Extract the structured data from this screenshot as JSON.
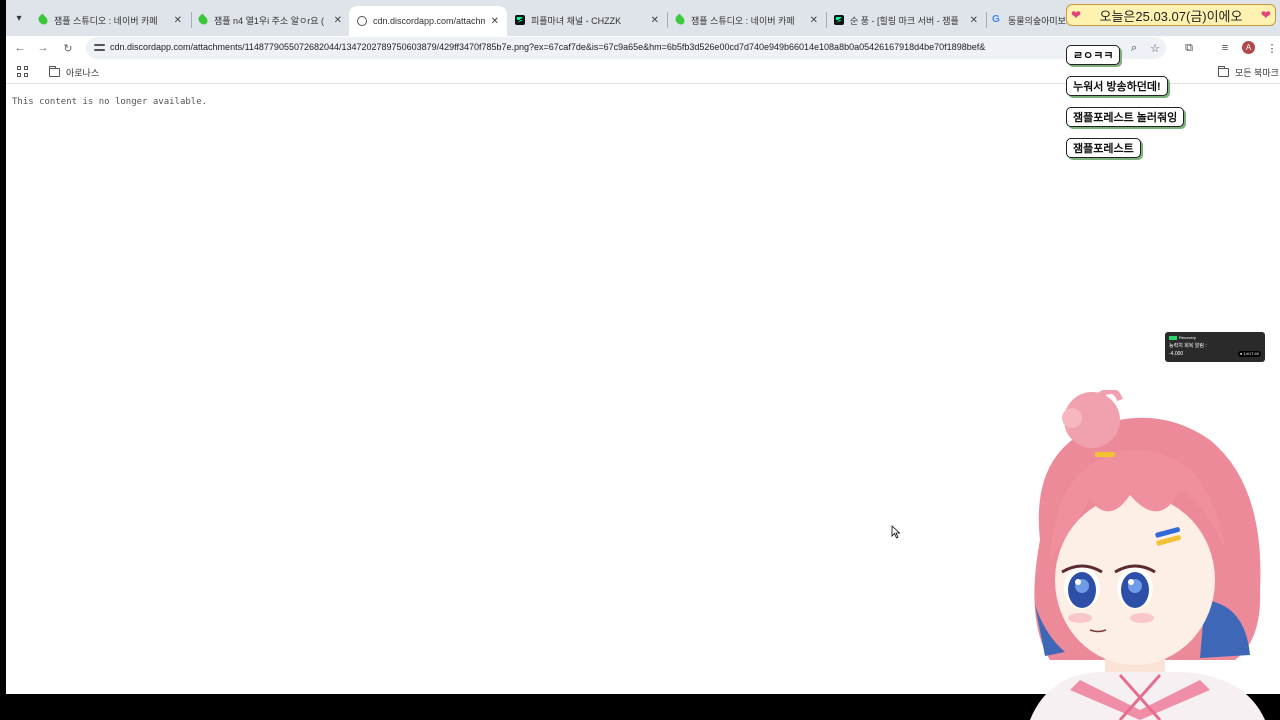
{
  "tabs": [
    {
      "title": "잼플 스튜디오 : 네이버 카페",
      "favicon": "leaf-icon",
      "active": false
    },
    {
      "title": "잼플 n4 열1우i 주소 알ㅇr요 (",
      "favicon": "leaf-icon",
      "active": false
    },
    {
      "title": "cdn.discordapp.com/attachme",
      "favicon": "globe-icon",
      "active": true
    },
    {
      "title": "피플마녀 채널 - CHZZK",
      "favicon": "chzzk-icon",
      "active": false
    },
    {
      "title": "잼플 스튜디오 : 네이버 카페",
      "favicon": "leaf-icon",
      "active": false
    },
    {
      "title": "순 풍 - [힐링 마크 서버 - 잼플",
      "favicon": "chzzk-icon",
      "active": false
    },
    {
      "title": "동물의숲아미보카",
      "favicon": "google-icon",
      "active": false
    }
  ],
  "tab_close_glyph": "✕",
  "google_glyph": "G",
  "url": "cdn.discordapp.com/attachments/1148779055072682044/1347202789750603879/429ff3470f785b7e.png?ex=67caf7de&is=67c9a65e&hm=6b5fb3d526e00cd7d740e949b66014e108a8b0a05426167918d4be70f1898bef&",
  "avatar_letter": "A",
  "bookmarks": {
    "folder": "아로나스",
    "all_bookmarks": "모든 북마크"
  },
  "content": {
    "message": "This content is no longer available."
  },
  "overlay": {
    "date_banner": "오늘은25.03.07(금)이에오",
    "chat": [
      "ㄹㅇㅋㅋ",
      "누워서 방송하던데!",
      "잼플포레스트 놀러줘잉",
      "잼플포레스트"
    ],
    "notification": {
      "brand": "Recovery",
      "title": "능력치 회복 알림 :",
      "value": "-4,000",
      "time": "● 14/17:40"
    }
  }
}
